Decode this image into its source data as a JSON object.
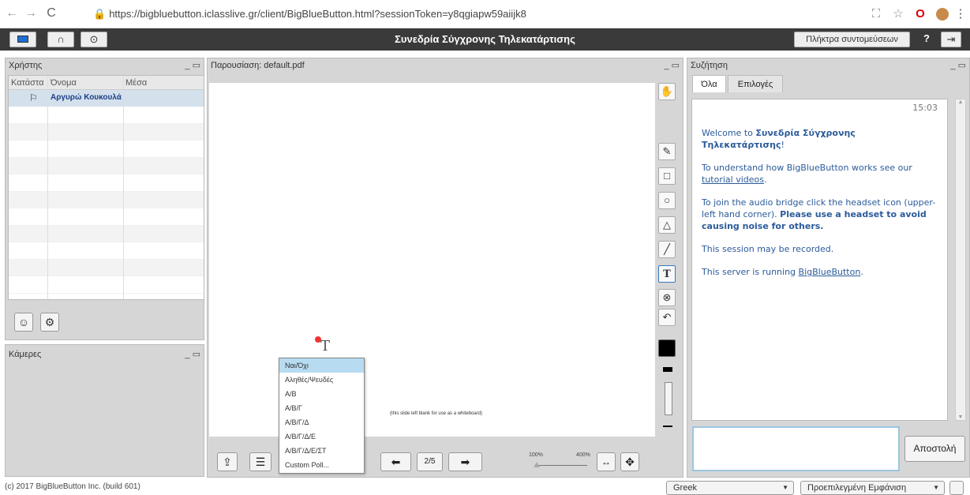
{
  "browser": {
    "url": "https://bigbluebutton.iclasslive.gr/client/BigBlueButton.html?sessionToken=y8qgiapw59aiijk8"
  },
  "toolbar": {
    "title": "Συνεδρία Σύγχρονης Τηλεκατάρτισης",
    "shortcuts": "Πλήκτρα συντομεύσεων",
    "help": "?"
  },
  "users": {
    "title": "Χρήστης",
    "col_status": "Κατάστα",
    "col_name": "Όνομα",
    "col_media": "Μέσα",
    "user_name": "Αργυρώ Κουκουλά"
  },
  "cams": {
    "title": "Κάμερες"
  },
  "presentation": {
    "title": "Παρουσίαση: default.pdf",
    "slide_text": "(this slide left blank for use as a whiteboard)",
    "page": "2/5",
    "zoom_min": "100%",
    "zoom_max": "400%"
  },
  "poll_menu": {
    "items": [
      "Ναι/Όχι",
      "Αληθές/Ψευδές",
      "Α/Β",
      "Α/Β/Γ",
      "Α/Β/Γ/Δ",
      "Α/Β/Γ/Δ/Ε",
      "Α/Β/Γ/Δ/Ε/ΣΤ",
      "Custom Poll..."
    ]
  },
  "chat": {
    "title": "Συζήτηση",
    "tab_all": "Όλα",
    "tab_options": "Επιλογές",
    "time": "15:03",
    "welcome_pre": "Welcome to ",
    "welcome_bold": "Συνεδρία Σύγχρονης Τηλεκατάρτισης",
    "welcome_post": "!",
    "tutorial_pre": "To understand how BigBlueButton works see our ",
    "tutorial_link": "tutorial videos",
    "tutorial_post": ".",
    "audio_pre": "To join the audio bridge click the headset icon (upper-left hand corner). ",
    "audio_bold": "Please use a headset to avoid causing noise for others.",
    "recorded": "This session may be recorded.",
    "server_pre": "This server is running ",
    "server_link": "BigBlueButton",
    "server_post": ".",
    "send": "Αποστολή"
  },
  "footer": {
    "copyright": "(c) 2017 BigBlueButton Inc. (build 601)",
    "language": "Greek",
    "layout": "Προεπιλεγμένη Εμφάνιση"
  },
  "colors": {
    "toolbar_bg": "#3a3a3a",
    "panel_bg": "#d6d6d6",
    "chat_text": "#2b5b9a",
    "poll_selected": "#b7dcf2"
  }
}
